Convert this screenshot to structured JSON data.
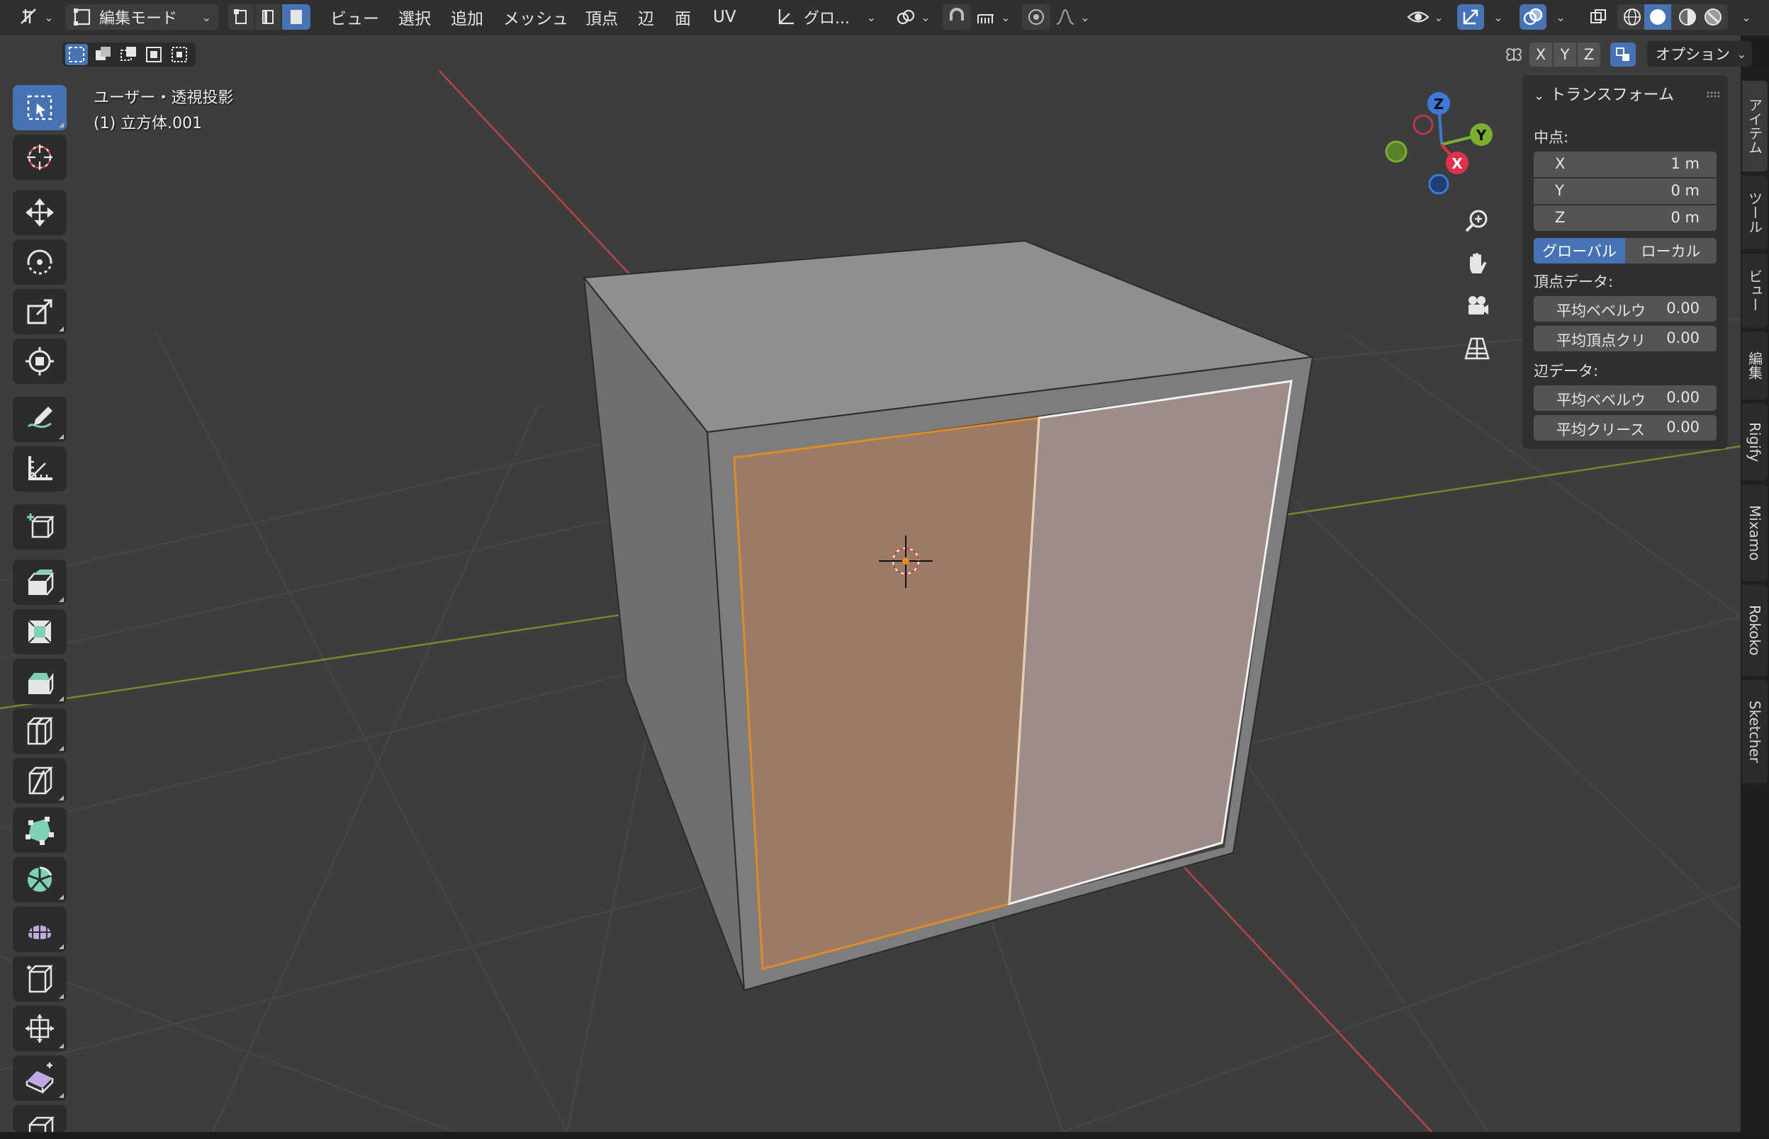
{
  "header": {
    "editor_type_icon": "editor-type-icon",
    "mode_label": "編集モード",
    "menus": [
      "ビュー",
      "選択",
      "追加",
      "メッシュ",
      "頂点",
      "辺",
      "面",
      "UV"
    ],
    "transform_orientation": "グロ...",
    "select_modes": [
      "vertex-select-mode",
      "edge-select-mode",
      "face-select-mode"
    ],
    "active_select_mode": "face-select-mode"
  },
  "subheader": {
    "axes": [
      "X",
      "Y",
      "Z"
    ],
    "options_label": "オプション"
  },
  "viewport": {
    "view_label": "ユーザー・透視投影",
    "object_label": "(1) 立方体.001",
    "gizmo_axes": {
      "x": "X",
      "y": "Y",
      "z": "Z"
    },
    "colors": {
      "background": "#3d3d3d",
      "grid": "#4a4a4a",
      "x_axis": "#c84a4a",
      "y_axis": "#7a9a30",
      "selected_face": "#9a7a6a",
      "selected_edge": "#e88a20"
    }
  },
  "toolbar": {
    "tools": [
      "select-box",
      "cursor",
      "move",
      "rotate",
      "scale",
      "transform",
      "annotate",
      "measure",
      "add-cube",
      "extrude",
      "inset",
      "bevel",
      "loop-cut",
      "knife",
      "poly-build",
      "spin",
      "smooth",
      "edge-slide",
      "shrink-fatten",
      "shear",
      "rip"
    ],
    "active_tool": "select-box"
  },
  "npanel": {
    "title": "トランスフォーム",
    "median_label": "中点:",
    "median": [
      {
        "axis": "X",
        "value": "1 m"
      },
      {
        "axis": "Y",
        "value": "0 m"
      },
      {
        "axis": "Z",
        "value": "0 m"
      }
    ],
    "space_options": [
      "グローバル",
      "ローカル"
    ],
    "active_space": "グローバル",
    "vertex_data_label": "頂点データ:",
    "vertex_data": [
      {
        "label": "平均ベベルウ",
        "value": "0.00"
      },
      {
        "label": "平均頂点クリ",
        "value": "0.00"
      }
    ],
    "edge_data_label": "辺データ:",
    "edge_data": [
      {
        "label": "平均ベベルウ",
        "value": "0.00"
      },
      {
        "label": "平均クリース",
        "value": "0.00"
      }
    ]
  },
  "sidetabs": [
    "アイテム",
    "ツール",
    "ビュー",
    "編集",
    "Rigify",
    "Mixamo",
    "Rokoko",
    "Sketcher"
  ],
  "active_sidetab": "アイテム"
}
